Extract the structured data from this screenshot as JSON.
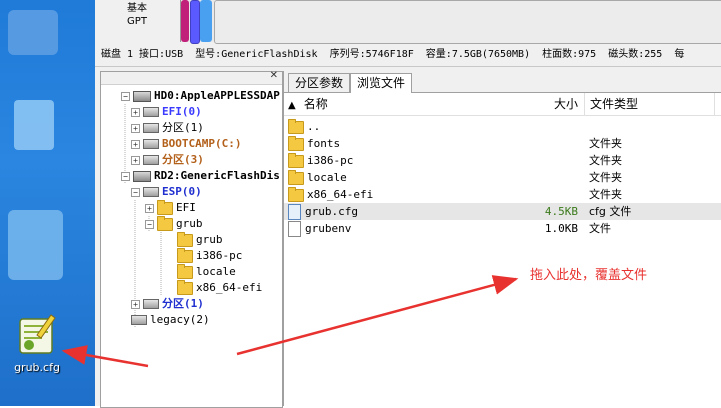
{
  "desktop": {
    "shortcut_label": "grub.cfg",
    "shortcut_icon": "notepad-plus-plus-icon"
  },
  "toolbar": {
    "mode_line1": "基本",
    "mode_line2": "GPT"
  },
  "disk_info": {
    "disk": "磁盘 1 接口:USB",
    "model": "型号:GenericFlashDisk",
    "serial": "序列号:5746F18F",
    "capacity": "容量:7.5GB(7650MB)",
    "cylinders": "柱面数:975",
    "heads": "磁头数:255",
    "sectors": "每"
  },
  "tree": {
    "nodes": [
      {
        "id": "hd0",
        "label": "HD0:AppleAPPLESSDAP",
        "color": "#000000",
        "bold": true,
        "expander": "−",
        "icon": "hard-disk-icon"
      },
      {
        "id": "efi0",
        "label": "EFI(0)",
        "color": "#3a3aff",
        "bold": true,
        "expander": "+",
        "icon": "partition-icon"
      },
      {
        "id": "part1",
        "label": "分区(1)",
        "color": "#000000",
        "bold": false,
        "expander": "+",
        "icon": "partition-icon"
      },
      {
        "id": "bootcamp",
        "label": "BOOTCAMP(C:)",
        "color": "#b3601a",
        "bold": true,
        "expander": "+",
        "icon": "partition-icon"
      },
      {
        "id": "part3",
        "label": "分区(3)",
        "color": "#b3601a",
        "bold": true,
        "expander": "+",
        "icon": "partition-icon"
      },
      {
        "id": "rd2",
        "label": "RD2:GenericFlashDis",
        "color": "#000000",
        "bold": true,
        "expander": "−",
        "icon": "hard-disk-icon"
      },
      {
        "id": "esp0",
        "label": "ESP(0)",
        "color": "#1f2fcf",
        "bold": true,
        "expander": "−",
        "icon": "partition-icon"
      },
      {
        "id": "efi",
        "label": "EFI",
        "color": "#000000",
        "bold": false,
        "expander": "+",
        "icon": "folder-icon"
      },
      {
        "id": "grub",
        "label": "grub",
        "color": "#000000",
        "bold": false,
        "expander": "−",
        "icon": "folder-open-icon"
      },
      {
        "id": "grub-sub",
        "label": "grub",
        "color": "#000000",
        "bold": false,
        "expander": "",
        "icon": "folder-icon"
      },
      {
        "id": "i386",
        "label": "i386-pc",
        "color": "#000000",
        "bold": false,
        "expander": "",
        "icon": "folder-icon"
      },
      {
        "id": "locale",
        "label": "locale",
        "color": "#000000",
        "bold": false,
        "expander": "",
        "icon": "folder-icon"
      },
      {
        "id": "x86",
        "label": "x86_64-efi",
        "color": "#000000",
        "bold": false,
        "expander": "",
        "icon": "folder-icon"
      },
      {
        "id": "part1b",
        "label": "分区(1)",
        "color": "#1f2fcf",
        "bold": true,
        "expander": "+",
        "icon": "partition-icon"
      },
      {
        "id": "legacy",
        "label": "legacy(2)",
        "color": "#000000",
        "bold": false,
        "expander": "",
        "icon": "partition-icon"
      }
    ]
  },
  "tabs": [
    {
      "label": "分区参数",
      "active": false
    },
    {
      "label": "浏览文件",
      "active": true
    }
  ],
  "columns": {
    "name": "名称",
    "size": "大小",
    "type": "文件类型"
  },
  "files": [
    {
      "name": "..",
      "size": "",
      "type": "",
      "icon": "folder-up-icon",
      "selected": false,
      "size_color": "#000000"
    },
    {
      "name": "fonts",
      "size": "",
      "type": "文件夹",
      "icon": "folder-icon",
      "selected": false,
      "size_color": "#000000"
    },
    {
      "name": "i386-pc",
      "size": "",
      "type": "文件夹",
      "icon": "folder-icon",
      "selected": false,
      "size_color": "#000000"
    },
    {
      "name": "locale",
      "size": "",
      "type": "文件夹",
      "icon": "folder-icon",
      "selected": false,
      "size_color": "#000000"
    },
    {
      "name": "x86_64-efi",
      "size": "",
      "type": "文件夹",
      "icon": "folder-icon",
      "selected": false,
      "size_color": "#000000"
    },
    {
      "name": "grub.cfg",
      "size": "4.5KB",
      "type": "cfg 文件",
      "icon": "cfg-file-icon",
      "selected": true,
      "size_color": "#3a7a1a"
    },
    {
      "name": "grubenv",
      "size": "1.0KB",
      "type": "文件",
      "icon": "file-icon",
      "selected": false,
      "size_color": "#000000"
    }
  ],
  "annotation": {
    "text": "拖入此处，覆盖文件",
    "color": "#e8322f"
  }
}
